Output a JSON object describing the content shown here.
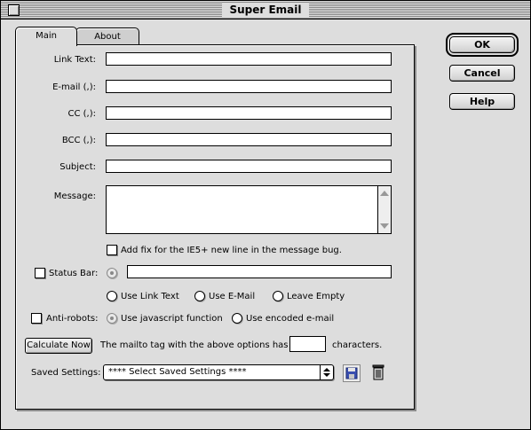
{
  "window": {
    "title": "Super Email"
  },
  "tabs": [
    {
      "label": "Main",
      "active": true
    },
    {
      "label": "About",
      "active": false
    }
  ],
  "form": {
    "link_text": {
      "label": "Link Text:",
      "value": ""
    },
    "email": {
      "label": "E-mail (,):",
      "value": ""
    },
    "cc": {
      "label": "CC (,):",
      "value": ""
    },
    "bcc": {
      "label": "BCC (,):",
      "value": ""
    },
    "subject": {
      "label": "Subject:",
      "value": ""
    },
    "message": {
      "label": "Message:",
      "value": ""
    },
    "ie_fix": {
      "label": "Add fix for the IE5+ new line in the message bug.",
      "checked": false
    },
    "status_bar": {
      "label": "Status Bar:",
      "checked": false,
      "value": "",
      "options": [
        "Use Link Text",
        "Use E-Mail",
        "Leave Empty"
      ]
    },
    "anti_robots": {
      "label": "Anti-robots:",
      "checked": false,
      "options": [
        "Use javascript function",
        "Use encoded e-mail"
      ],
      "selected": "Use javascript function"
    },
    "calculate": {
      "button_label": "Calculate Now",
      "text_before": "The mailto tag with the above options has got",
      "count": "",
      "text_after": "characters."
    },
    "saved_settings": {
      "label": "Saved Settings:",
      "selected": "**** Select Saved Settings ****"
    }
  },
  "buttons": {
    "ok": "OK",
    "cancel": "Cancel",
    "help": "Help"
  },
  "icons": {
    "save": "floppy-disk-icon",
    "delete": "trash-can-icon"
  },
  "colors": {
    "window_bg": "#dddddd",
    "field_bg": "#ffffff",
    "disk_blue": "#3a4fb0"
  }
}
